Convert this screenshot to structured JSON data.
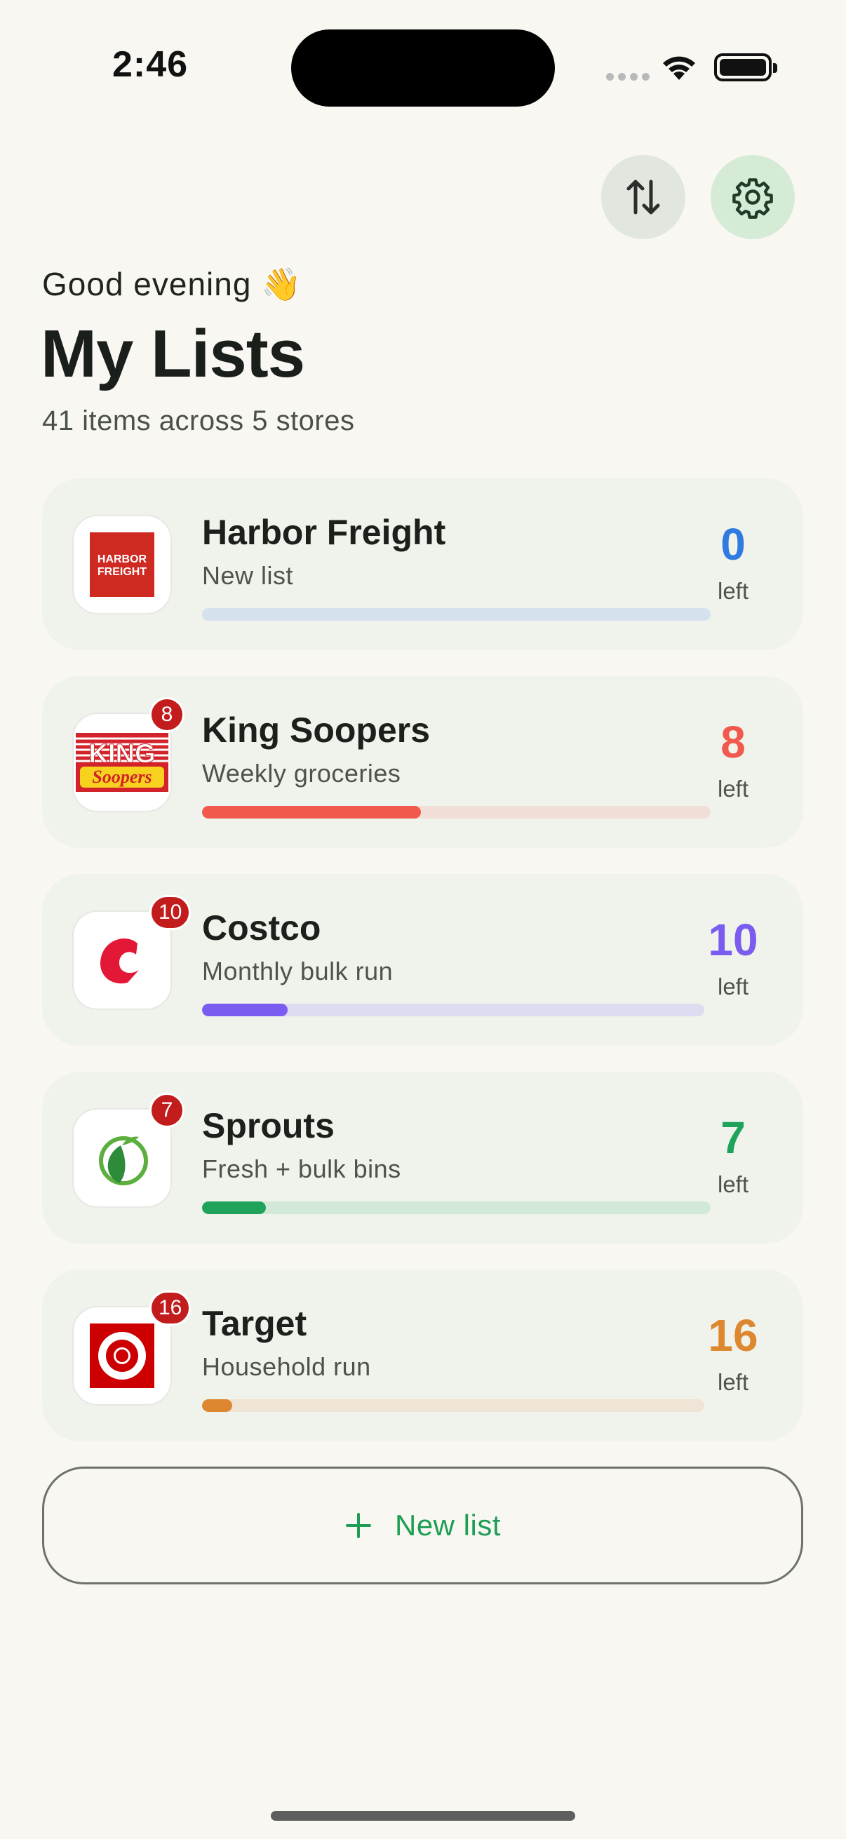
{
  "status": {
    "time": "2:46"
  },
  "header": {
    "greeting": "Good evening 👋",
    "title": "My Lists",
    "summary": "41 items across 5 stores"
  },
  "lists": [
    {
      "name": "Harbor Freight",
      "subtitle": "New list",
      "left": "0",
      "left_label": "left",
      "badge": "",
      "progress": 0,
      "accent": "#2F7BE0",
      "track": "#D5E1EC",
      "logo_text": [
        "HARBOR",
        "FREIGHT"
      ]
    },
    {
      "name": "King Soopers",
      "subtitle": "Weekly groceries",
      "left": "8",
      "left_label": "left",
      "badge": "8",
      "progress": 0.43,
      "accent": "#F0594C",
      "track": "#F1DED7",
      "logo_text": [
        "KING",
        "Soopers"
      ]
    },
    {
      "name": "Costco",
      "subtitle": "Monthly bulk run",
      "left": "10",
      "left_label": "left",
      "badge": "10",
      "progress": 0.17,
      "accent": "#7A5CF0",
      "track": "#DEDCF0",
      "logo_text": []
    },
    {
      "name": "Sprouts",
      "subtitle": "Fresh + bulk bins",
      "left": "7",
      "left_label": "left",
      "badge": "7",
      "progress": 0.125,
      "accent": "#1FA35A",
      "track": "#D3E9D7",
      "logo_text": []
    },
    {
      "name": "Target",
      "subtitle": "Household run",
      "left": "16",
      "left_label": "left",
      "badge": "16",
      "progress": 0.06,
      "accent": "#DD8830",
      "track": "#EFE4D5",
      "logo_text": []
    }
  ],
  "new_list": {
    "label": "New list"
  },
  "icons": {
    "sort": "arrows-up-down-icon",
    "settings": "gear-icon",
    "add": "plus-icon"
  }
}
